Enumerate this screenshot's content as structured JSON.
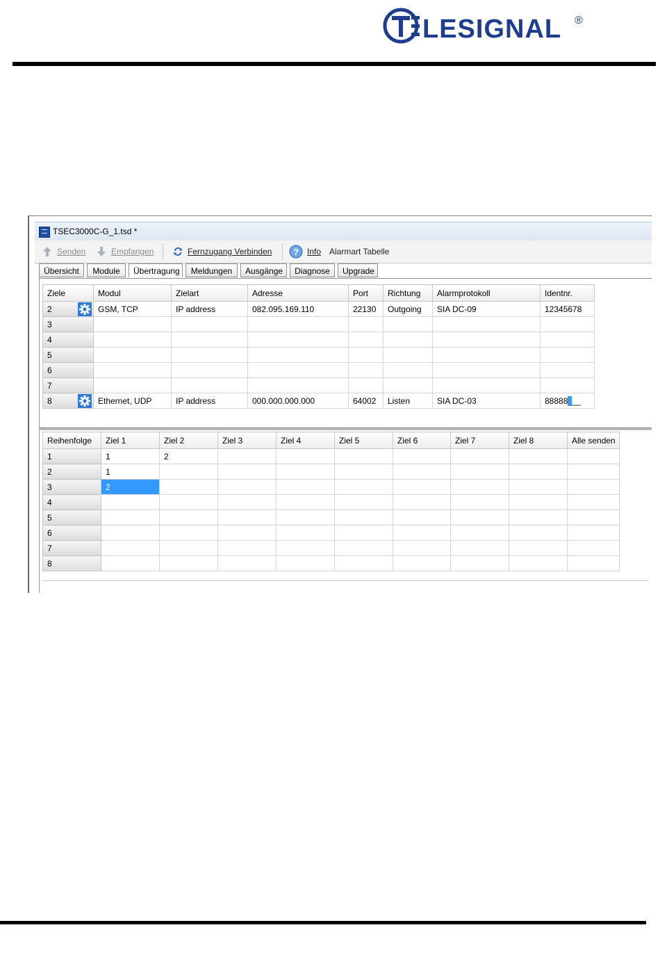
{
  "brand": {
    "name": "TELESIGNAL",
    "registered": "®"
  },
  "window": {
    "title": "TSEC3000C-G_1.tsd  *"
  },
  "toolbar": {
    "senden": "Senden",
    "empfangen": "Empfangen",
    "fernzugang": "Fernzugang Verbinden",
    "info": "Info",
    "alarmart": "Alarmart Tabelle"
  },
  "tabs": [
    "Übersicht",
    "Module",
    "Übertragung",
    "Meldungen",
    "Ausgänge",
    "Diagnose",
    "Upgrade"
  ],
  "active_tab": "Übertragung",
  "ziele_table": {
    "columns": [
      "Ziele",
      "Modul",
      "Zielart",
      "Adresse",
      "Port",
      "Richtung",
      "Alarmprotokoll",
      "Identnr."
    ],
    "rows": [
      {
        "id": "2",
        "modul": "GSM, TCP",
        "zielart": "IP address",
        "adresse": "082.095.169.110",
        "port": "22130",
        "richtung": "Outgoing",
        "protokoll": "SIA DC-09",
        "identnr": "12345678"
      },
      {
        "id": "3",
        "modul": "",
        "zielart": "",
        "adresse": "",
        "port": "",
        "richtung": "",
        "protokoll": "",
        "identnr": ""
      },
      {
        "id": "4",
        "modul": "",
        "zielart": "",
        "adresse": "",
        "port": "",
        "richtung": "",
        "protokoll": "",
        "identnr": ""
      },
      {
        "id": "5",
        "modul": "",
        "zielart": "",
        "adresse": "",
        "port": "",
        "richtung": "",
        "protokoll": "",
        "identnr": ""
      },
      {
        "id": "6",
        "modul": "",
        "zielart": "",
        "adresse": "",
        "port": "",
        "richtung": "",
        "protokoll": "",
        "identnr": ""
      },
      {
        "id": "7",
        "modul": "",
        "zielart": "",
        "adresse": "",
        "port": "",
        "richtung": "",
        "protokoll": "",
        "identnr": ""
      },
      {
        "id": "8",
        "modul": "Ethernet, UDP",
        "zielart": "IP address",
        "adresse": "000.000.000.000",
        "port": "64002",
        "richtung": "Listen",
        "protokoll": "SIA DC-03",
        "identnr": "88888"
      }
    ]
  },
  "reihenfolge_table": {
    "columns": [
      "Reihenfolge",
      "Ziel 1",
      "Ziel 2",
      "Ziel 3",
      "Ziel 4",
      "Ziel 5",
      "Ziel 6",
      "Ziel 7",
      "Ziel 8",
      "Alle senden"
    ],
    "rows": [
      [
        "1",
        "1",
        "2",
        "",
        "",
        "",
        "",
        "",
        "",
        ""
      ],
      [
        "2",
        "1",
        "",
        "",
        "",
        "",
        "",
        "",
        "",
        ""
      ],
      [
        "3",
        "2",
        "",
        "",
        "",
        "",
        "",
        "",
        "",
        ""
      ],
      [
        "4",
        "",
        "",
        "",
        "",
        "",
        "",
        "",
        "",
        ""
      ],
      [
        "5",
        "",
        "",
        "",
        "",
        "",
        "",
        "",
        "",
        ""
      ],
      [
        "6",
        "",
        "",
        "",
        "",
        "",
        "",
        "",
        "",
        ""
      ],
      [
        "7",
        "",
        "",
        "",
        "",
        "",
        "",
        "",
        "",
        ""
      ],
      [
        "8",
        "",
        "",
        "",
        "",
        "",
        "",
        "",
        "",
        ""
      ]
    ]
  },
  "colors": {
    "brand_blue": "#1f3d8f",
    "selection_blue": "#3399ff",
    "gear_blue": "#2d7ad6"
  }
}
